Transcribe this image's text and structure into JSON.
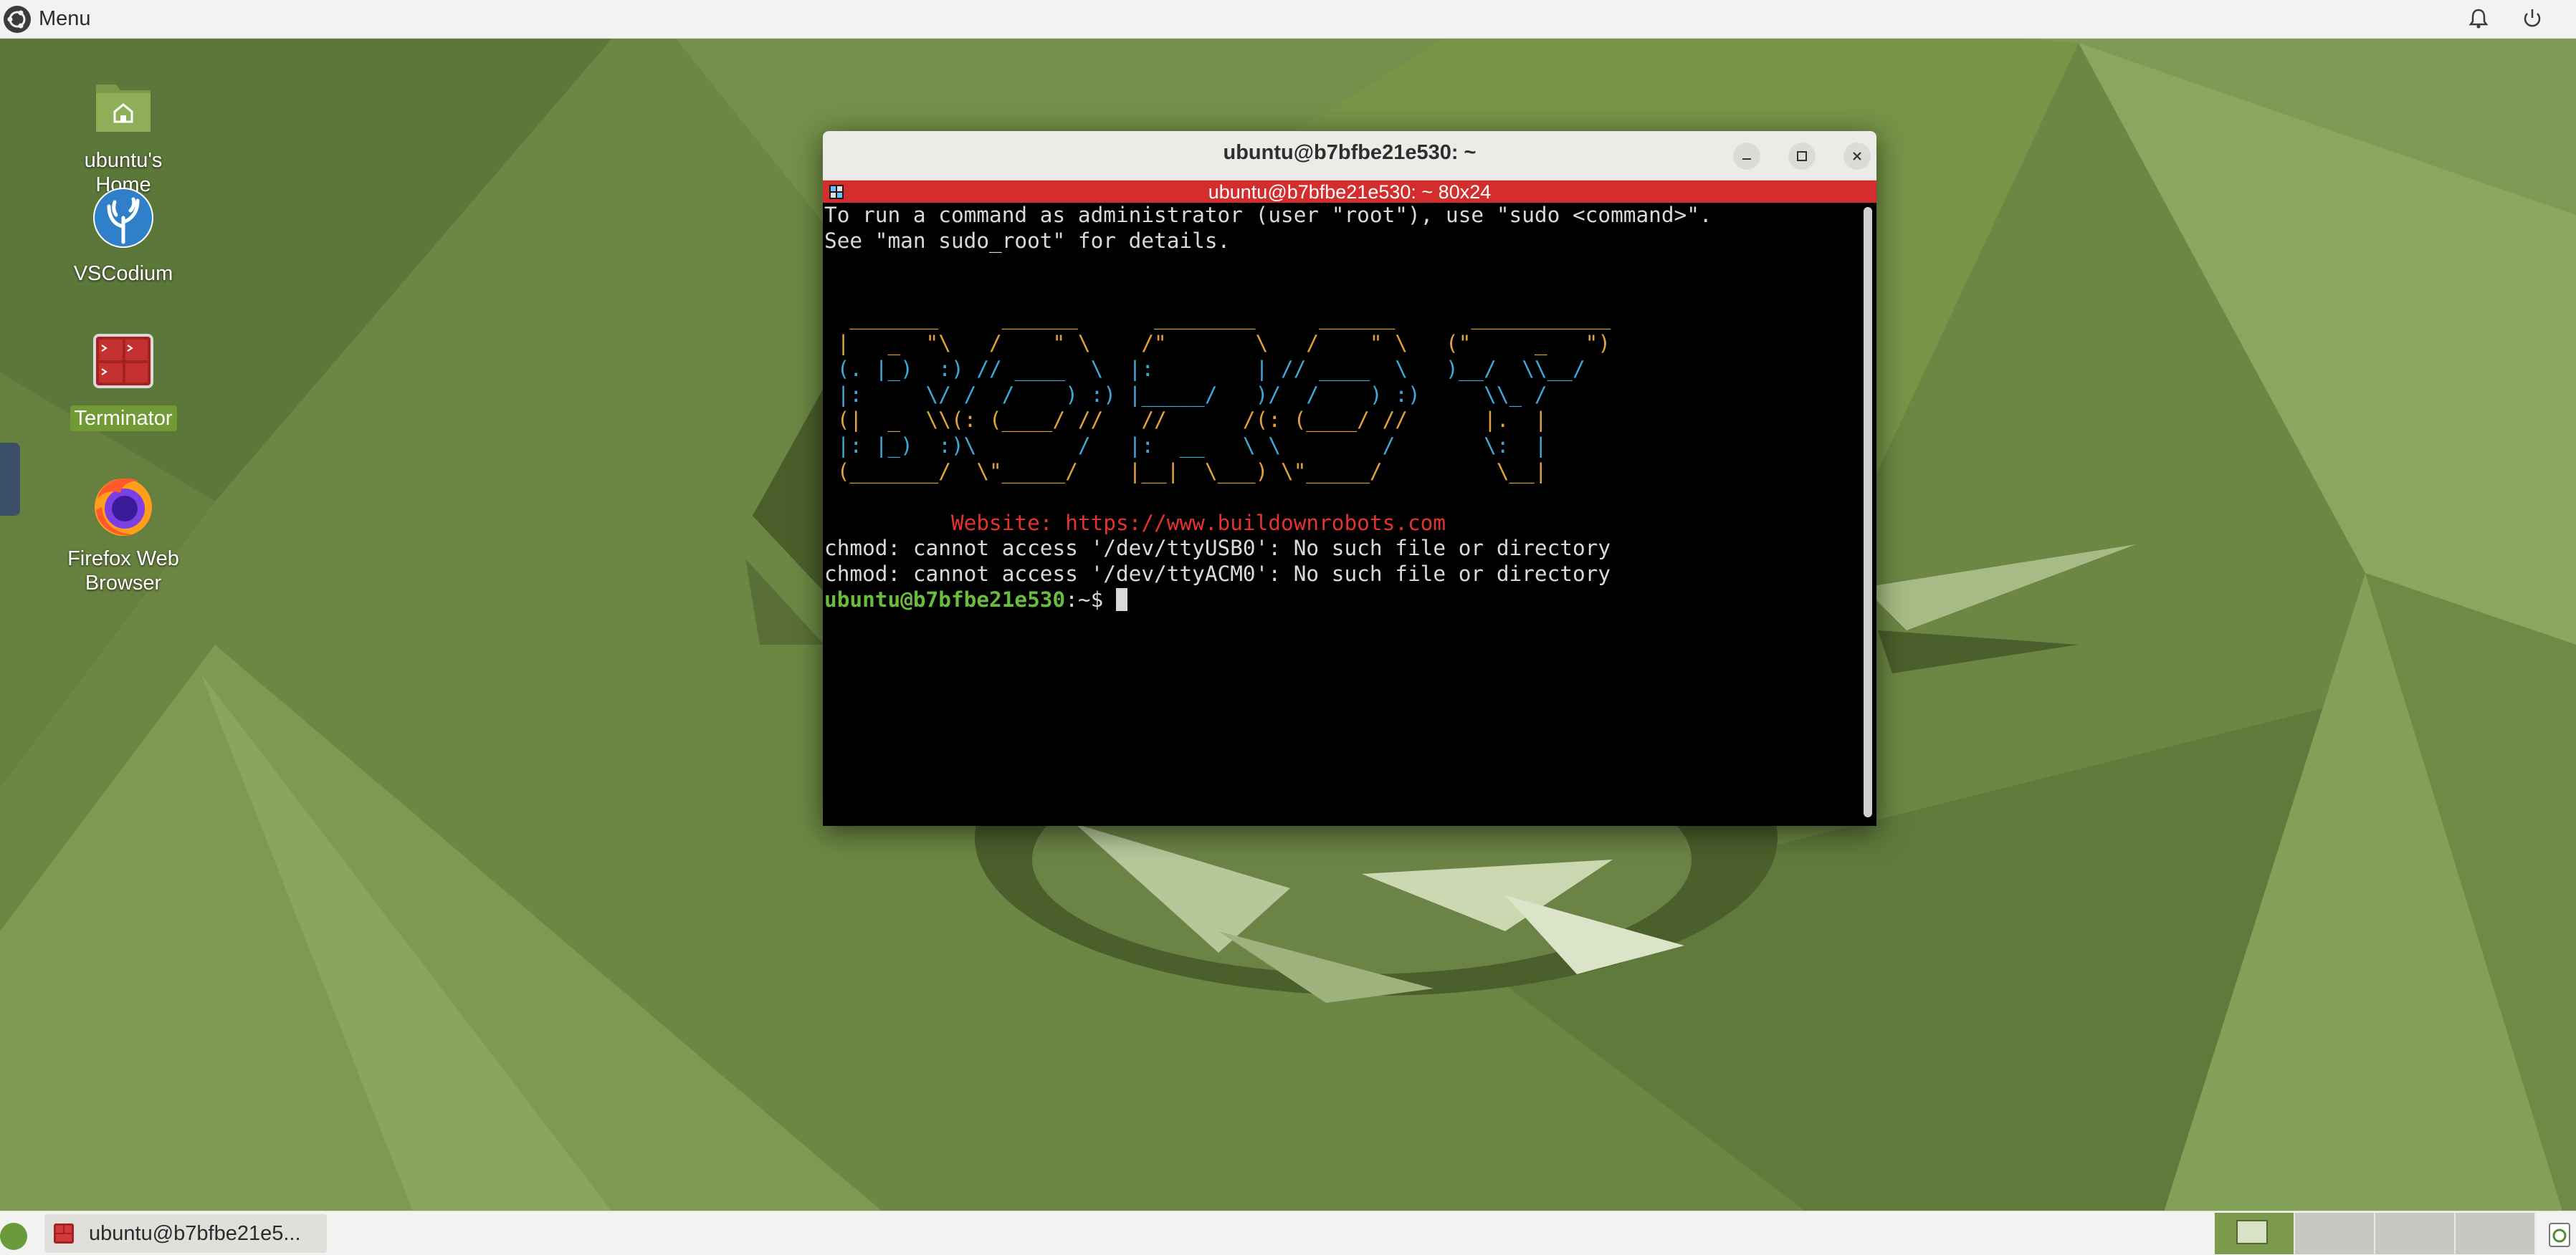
{
  "top_panel": {
    "menu_label": "Menu",
    "notification_icon": "bell-icon",
    "power_icon": "power-icon"
  },
  "desktop_icons": [
    {
      "label": "ubuntu's Home",
      "icon": "home-folder-icon"
    },
    {
      "label": "VSCodium",
      "icon": "vscodium-icon"
    },
    {
      "label": "Terminator",
      "icon": "terminator-icon",
      "selected": true
    },
    {
      "label": "Firefox Web Browser",
      "icon": "firefox-icon"
    }
  ],
  "terminal": {
    "window_title": "ubuntu@b7bfbe21e530: ~",
    "subtitle": "ubuntu@b7bfbe21e530: ~ 80x24",
    "lines": {
      "l1": "To run a command as administrator (user \"root\"), use \"sudo <command>\".",
      "l2": "See \"man sudo_root\" for details.",
      "art1": "  _______     ______      ________     ______      ___________",
      "art2": " |   _  \"\\   /    \" \\    /\"       \\   /    \" \\   (\"     _   \")",
      "art3": " (. |_)  :) // ____  \\  |:        | // ____  \\   )__/  \\\\__/",
      "art4": " |:     \\/ /  /    ) :) |_____/   )/  /    ) :)     \\\\_ /",
      "art5": " (|  _  \\\\(: (____/ //   //      /(: (____/ //      |.  |",
      "art6": " |: |_)  :)\\        /   |:  __   \\ \\        /       \\:  |",
      "art7": " (_______/  \\\"_____/    |__|  \\___) \\\"_____/         \\__|",
      "website": "          Website: https://www.buildownrobots.com",
      "err1": "chmod: cannot access '/dev/ttyUSB0': No such file or directory",
      "err2": "chmod: cannot access '/dev/ttyACM0': No such file or directory",
      "prompt_user": "ubuntu@b7bfbe21e530",
      "prompt_path": ":~$ "
    }
  },
  "taskbar": {
    "task_label": "ubuntu@b7bfbe21e5...",
    "workspaces": 4,
    "active_workspace": 1
  },
  "colors": {
    "terminal_subbar": "#d42d2d",
    "prompt_green": "#69bd3c",
    "art_orange": "#e2a13a",
    "art_blue": "#3fa7d6",
    "website_red": "#e3332e"
  }
}
